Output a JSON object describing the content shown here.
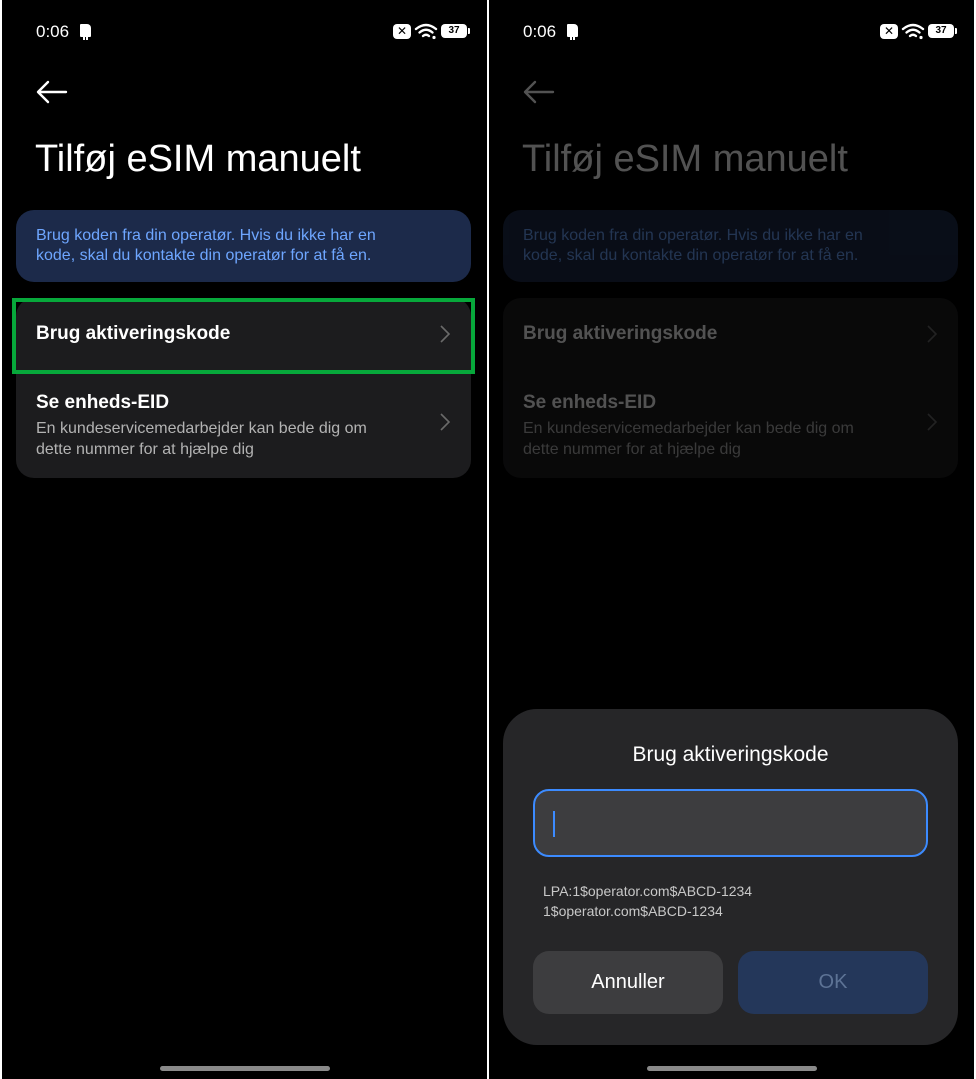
{
  "status_bar": {
    "time": "0:06",
    "battery": "37",
    "x_badge": "✕"
  },
  "page": {
    "title": "Tilføj eSIM manuelt",
    "info_line1": "Brug koden fra din operatør. Hvis du ikke har en",
    "info_line2": "kode, skal du kontakte din operatør for at få en."
  },
  "menu": {
    "activation_code_label": "Brug aktiveringskode",
    "eid_label": "Se enheds-EID",
    "eid_sub_line1": "En kundeservicemedarbejder kan bede dig om",
    "eid_sub_line2": "dette nummer for at hjælpe dig"
  },
  "dialog": {
    "title": "Brug aktiveringskode",
    "input_value": "",
    "hint_line1": "LPA:1$operator.com$ABCD-1234",
    "hint_line2": "1$operator.com$ABCD-1234",
    "cancel_label": "Annuller",
    "ok_label": "OK"
  },
  "colors": {
    "accent": "#3c8bff",
    "highlight": "#07a83b",
    "info_bg": "#1c2a4a",
    "info_text": "#6ea6ff"
  }
}
